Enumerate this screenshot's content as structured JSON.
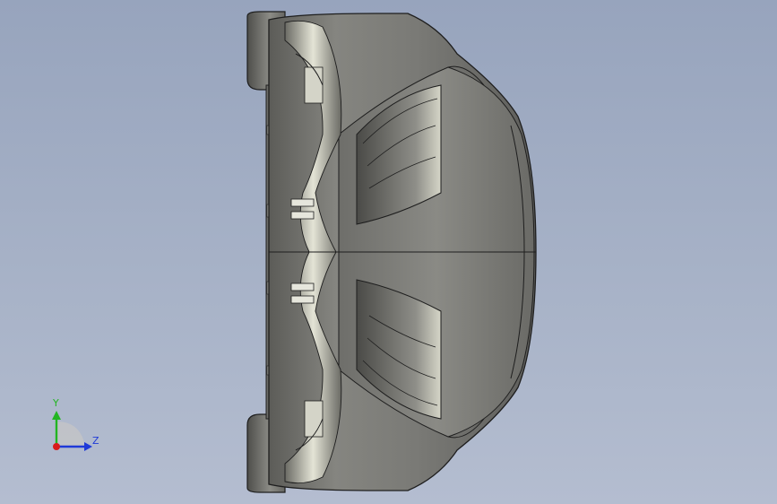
{
  "viewport": {
    "background_top": "#97a4bd",
    "background_bottom": "#b4bdd0"
  },
  "model": {
    "body_color": "#7a7a76",
    "edge_color": "#1e1e1e",
    "highlight_color": "#d8d8cc"
  },
  "triad": {
    "y_label": "Y",
    "z_label": "Z",
    "y_color": "#22b522",
    "z_color": "#1f3ad8",
    "x_color": "#d81b1b"
  }
}
